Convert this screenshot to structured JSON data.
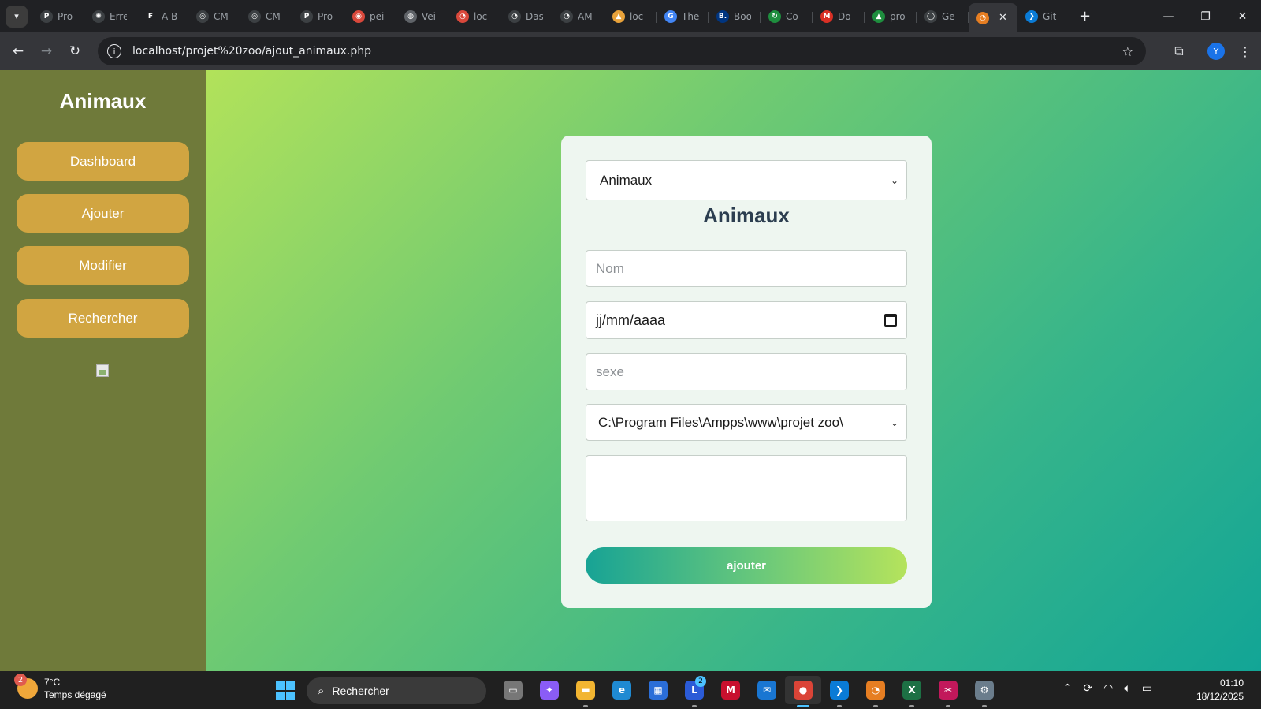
{
  "browser": {
    "tabs": [
      {
        "icon": "P",
        "title": "Pro",
        "color": "#3c4043"
      },
      {
        "icon": "✺",
        "title": "Erre",
        "color": "#3c4043"
      },
      {
        "icon": "F",
        "title": "A B",
        "color": "#202124"
      },
      {
        "icon": "◎",
        "title": "CM",
        "color": "#3c4043"
      },
      {
        "icon": "◎",
        "title": "CM",
        "color": "#3c4043"
      },
      {
        "icon": "P",
        "title": "Pro",
        "color": "#3c4043"
      },
      {
        "icon": "◉",
        "title": "pei",
        "color": "#d9483b"
      },
      {
        "icon": "◍",
        "title": "Vei",
        "color": "#5f6368"
      },
      {
        "icon": "◔",
        "title": "loc",
        "color": "#d9483b"
      },
      {
        "icon": "◔",
        "title": "Das",
        "color": "#3c4043"
      },
      {
        "icon": "◔",
        "title": "AM",
        "color": "#3c4043"
      },
      {
        "icon": "▲",
        "title": "loc",
        "color": "#e8a23a"
      },
      {
        "icon": "G",
        "title": "The",
        "color": "#4285f4"
      },
      {
        "icon": "B.",
        "title": "Boo",
        "color": "#003580"
      },
      {
        "icon": "↻",
        "title": "Co",
        "color": "#1e8e3e"
      },
      {
        "icon": "M",
        "title": "Do",
        "color": "#d93025"
      },
      {
        "icon": "▲",
        "title": "pro",
        "color": "#1e8e3e"
      },
      {
        "icon": "◯",
        "title": "Ge",
        "color": "#3c4043"
      }
    ],
    "active_tab": {
      "icon": "◔",
      "title": ""
    },
    "after_tab": {
      "icon": "❯",
      "title": "Git"
    },
    "url": "localhost/projet%20zoo/ajout_animaux.php",
    "profile_initial": "Y"
  },
  "sidebar": {
    "title": "Animaux",
    "items": [
      {
        "label": "Dashboard"
      },
      {
        "label": "Ajouter"
      },
      {
        "label": "Modifier"
      },
      {
        "label": "Rechercher"
      }
    ]
  },
  "form": {
    "category_select": "Animaux",
    "title": "Animaux",
    "name_placeholder": "Nom",
    "date_placeholder": "jj/mm/aaaa",
    "sex_placeholder": "sexe",
    "image_path": "C:\\Program Files\\Ampps\\www\\projet zoo\\",
    "description": "",
    "submit_label": "ajouter"
  },
  "taskbar": {
    "weather_badge": "2",
    "temperature": "7°C",
    "weather_text": "Temps dégagé",
    "search_label": "Rechercher",
    "apps": [
      {
        "name": "task-view",
        "color": "#777777",
        "symbol": "▭"
      },
      {
        "name": "copilot",
        "color": "#8a5cf6",
        "symbol": "✦"
      },
      {
        "name": "file-explorer",
        "color": "#f2b531",
        "symbol": "▬"
      },
      {
        "name": "edge",
        "color": "#1f8ad2",
        "symbol": "e"
      },
      {
        "name": "store",
        "color": "#2b6ed8",
        "symbol": "▦"
      },
      {
        "name": "teams-l",
        "color": "#2b5bd7",
        "symbol": "L"
      },
      {
        "name": "mcafee",
        "color": "#c8102e",
        "symbol": "M"
      },
      {
        "name": "outlook",
        "color": "#1976d2",
        "symbol": "✉"
      },
      {
        "name": "chrome",
        "color": "#db4437",
        "symbol": "●"
      },
      {
        "name": "vscode",
        "color": "#0a7bd6",
        "symbol": "❯"
      },
      {
        "name": "ampps",
        "color": "#e67e22",
        "symbol": "◔"
      },
      {
        "name": "excel",
        "color": "#1d7044",
        "symbol": "X"
      },
      {
        "name": "snipping",
        "color": "#c2185b",
        "symbol": "✂"
      },
      {
        "name": "settings",
        "color": "#6b7d8c",
        "symbol": "⚙"
      }
    ],
    "teams_badge": "2",
    "time": "01:10",
    "date": "18/12/2025"
  }
}
